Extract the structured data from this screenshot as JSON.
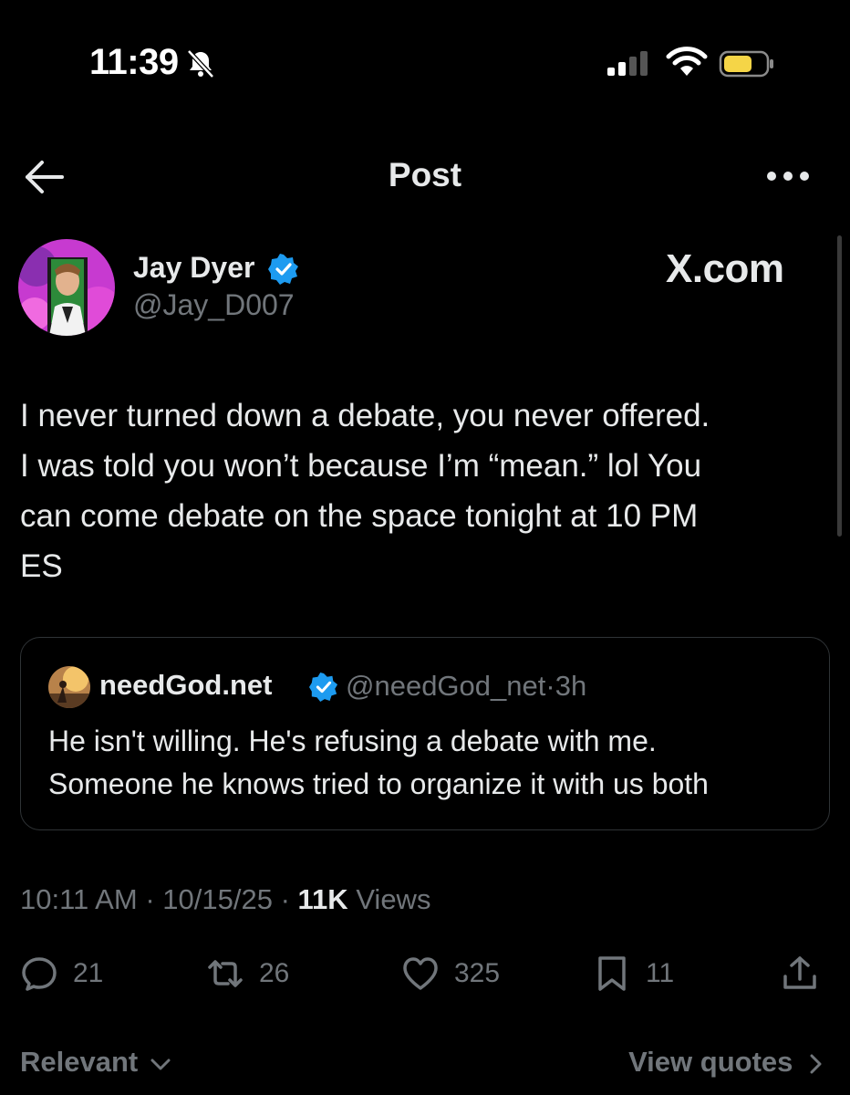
{
  "status_bar": {
    "time": "11:39"
  },
  "header": {
    "title": "Post"
  },
  "post": {
    "author_name": "Jay Dyer",
    "author_handle": "@Jay_D007",
    "watermark": "X.com",
    "text": "I never turned down a debate, you never offered.\nI was told you won’t because I’m “mean.” lol You\ncan come debate on the space tonight at 10 PM\nES",
    "time": "10:11 AM",
    "date": "10/15/25",
    "views_count": "11K",
    "views_label": "Views",
    "sep": "·"
  },
  "quote": {
    "author_name": "needGod.net",
    "handle": "@needGod_net",
    "age": "3h",
    "sep": "·",
    "text": "He isn't willing. He's refusing a debate with me.\nSomeone he knows tried to organize it with us both"
  },
  "actions": {
    "replies": "21",
    "reposts": "26",
    "likes": "325",
    "bookmarks": "11"
  },
  "footer": {
    "sort_label": "Relevant",
    "view_quotes_label": "View quotes"
  },
  "colors": {
    "background": "#000000",
    "text_primary": "#e7e9ea",
    "text_secondary": "#71767b",
    "verified": "#1d9bf0",
    "battery": "#f5d547"
  }
}
